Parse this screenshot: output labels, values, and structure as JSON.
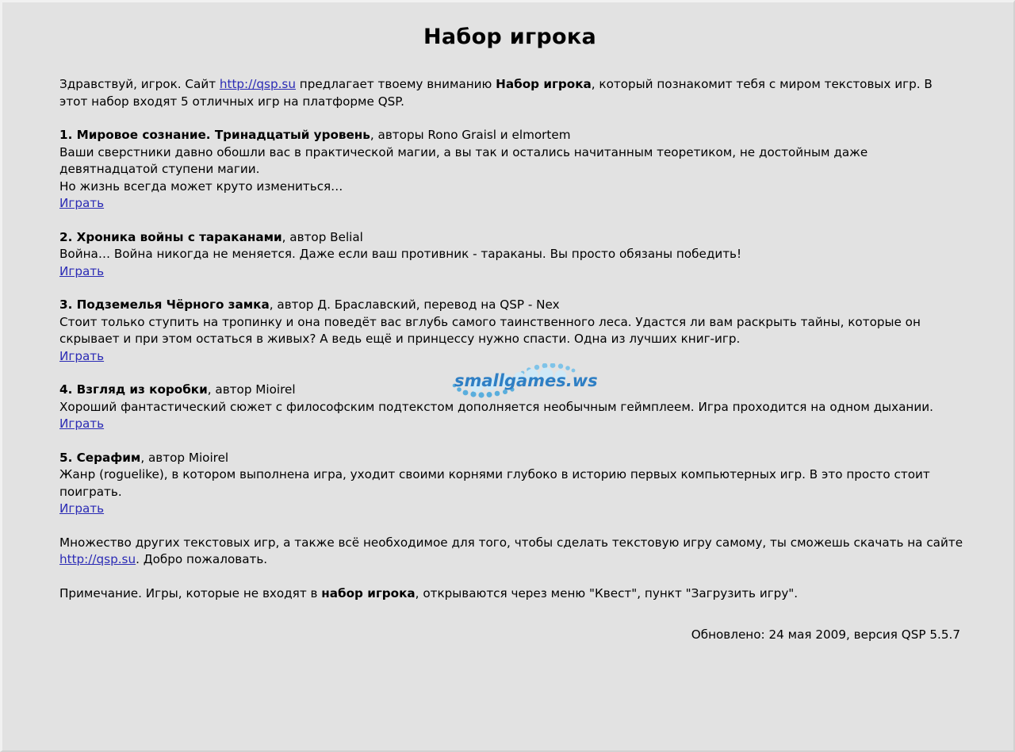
{
  "page": {
    "title": "Набор игрока",
    "background_color": "#e2e2e2",
    "link_color": "#2b2bb5",
    "watermark_color": "#2f7fc4"
  },
  "intro": {
    "part1": "Здравствуй, игрок. Сайт ",
    "site_link": "http://qsp.su",
    "part2": " предлагает твоему вниманию ",
    "bold": "Набор игрока",
    "part3": ", который познакомит тебя с миром текстовых игр. В этот набор входят 5 отличных игр на платформе QSP."
  },
  "games": [
    {
      "number": "1.",
      "name": " Мировое сознание. Тринадцатый уровень",
      "author": ", авторы Rono Graisl и elmortem",
      "description": "Ваши сверстники давно обошли вас в практической магии, а вы так и остались начитанным теоретиком, не достойным даже девятнадцатой ступени магии.",
      "description2": "Но жизнь всегда может круто измениться…",
      "play_label": "Играть"
    },
    {
      "number": "2.",
      "name": " Хроника войны с тараканами",
      "author": ", автор Belial",
      "description": "Война… Война никогда не меняется. Даже если ваш противник - тараканы. Вы просто обязаны победить!",
      "description2": "",
      "play_label": "Играть"
    },
    {
      "number": "3.",
      "name": " Подземелья Чёрного замка",
      "author": ", автор Д. Браславский, перевод на QSP - Nex",
      "description": "Стоит только ступить на тропинку и она поведёт вас вглубь самого таинственного леса. Удастся ли вам раскрыть тайны, которые он скрывает и при этом остаться в живых? А ведь ещё и принцессу нужно спасти. Одна из лучших книг-игр.",
      "description2": "",
      "play_label": "Играть"
    },
    {
      "number": "4.",
      "name": " Взгляд из коробки",
      "author": ", автор Mioirel",
      "description": "Хороший фантастический сюжет с философским подтекстом дополняется необычным геймплеем. Игра проходится на одном дыхании.",
      "description2": "",
      "play_label": "Играть"
    },
    {
      "number": "5.",
      "name": " Серафим",
      "author": ", автор Mioirel",
      "description": "Жанр (roguelike), в котором выполнена игра, уходит своими корнями глубоко в историю первых компьютерных игр. В это просто стоит поиграть.",
      "description2": "",
      "play_label": "Играть"
    }
  ],
  "outro": {
    "part1": "Множество других текстовых игр, а также всё необходимое для того, чтобы сделать текстовую игру самому, ты сможешь скачать на сайте ",
    "site_link": "http://qsp.su",
    "part2": ". Добро пожаловать."
  },
  "note": {
    "part1": "Примечание. Игры, которые не входят в ",
    "bold": "набор игрока",
    "part2": ", открываются через меню \"Квест\", пункт \"Загрузить игру\"."
  },
  "footer": {
    "updated": "Обновлено: 24 мая 2009, версия QSP 5.5.7"
  },
  "watermark": {
    "text": "smallgames.ws"
  }
}
